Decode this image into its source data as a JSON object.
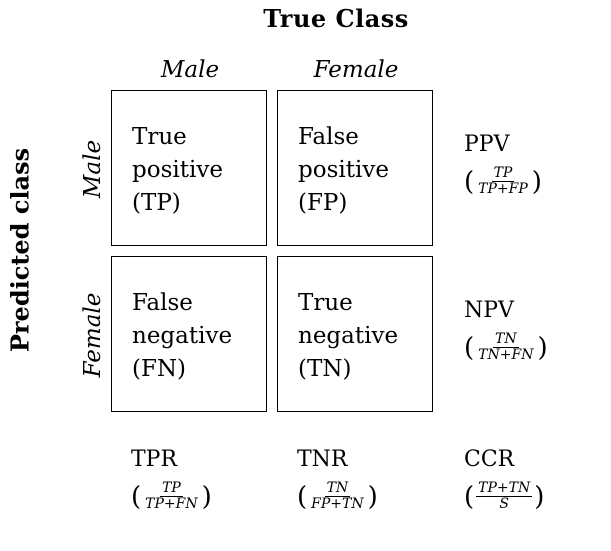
{
  "title_top": "True Class",
  "title_left": "Predicted class",
  "columns": [
    "Male",
    "Female"
  ],
  "rows": [
    "Male",
    "Female"
  ],
  "cells": [
    {
      "lines": [
        "True",
        "positive",
        "(TP)"
      ]
    },
    {
      "lines": [
        "False",
        "positive",
        "(FP)"
      ]
    },
    {
      "lines": [
        "False",
        "negative",
        "(FN)"
      ]
    },
    {
      "lines": [
        "True",
        "negative",
        "(TN)"
      ]
    }
  ],
  "row_metrics": [
    {
      "name": "PPV",
      "num": "TP",
      "den": "TP+FP"
    },
    {
      "name": "NPV",
      "num": "TN",
      "den": "TN+FN"
    }
  ],
  "col_metrics": [
    {
      "name": "TPR",
      "num": "TP",
      "den": "TP+FN"
    },
    {
      "name": "TNR",
      "num": "TN",
      "den": "FP+TN"
    },
    {
      "name": "CCR",
      "num": "TP+TN",
      "den": "S"
    }
  ],
  "paren_open": "(",
  "paren_close": ")"
}
